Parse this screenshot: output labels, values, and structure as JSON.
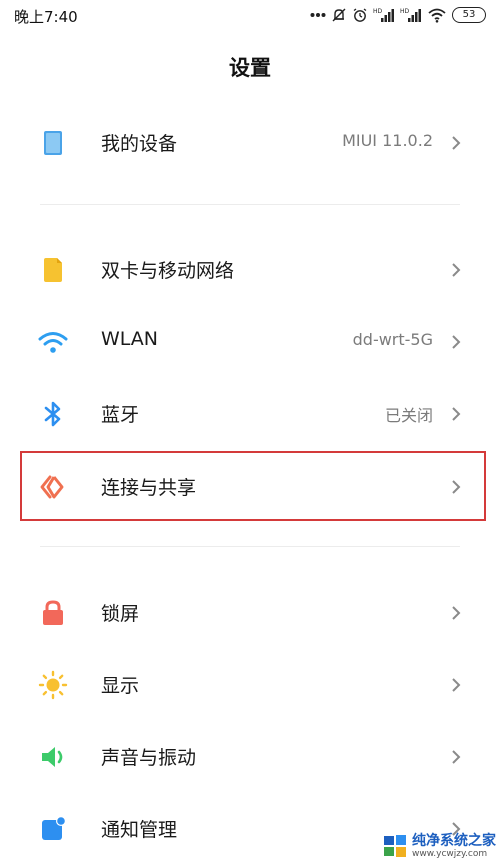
{
  "status_bar": {
    "time": "晚上7:40",
    "battery": "53",
    "icons": [
      "more-dots-icon",
      "alarm-off-icon",
      "alarm-icon",
      "signal-hd-icon",
      "signal-hd-icon",
      "wifi-icon",
      "battery-icon"
    ]
  },
  "title": "设置",
  "items": {
    "my_device": {
      "label": "我的设备",
      "value": "MIUI 11.0.2",
      "icon": "device-icon",
      "color": "#4aa3e8"
    },
    "sim": {
      "label": "双卡与移动网络",
      "value": "",
      "icon": "sim-card-icon",
      "color": "#f6c230"
    },
    "wlan": {
      "label": "WLAN",
      "value": "dd-wrt-5G",
      "icon": "wifi-icon",
      "color": "#2d9ef0"
    },
    "bluetooth": {
      "label": "蓝牙",
      "value": "已关闭",
      "icon": "bluetooth-icon",
      "color": "#2d8ff0"
    },
    "connection": {
      "label": "连接与共享",
      "value": "",
      "icon": "connection-share-icon",
      "color": "#f07050"
    },
    "lock": {
      "label": "锁屏",
      "value": "",
      "icon": "lock-icon",
      "color": "#f2685a"
    },
    "display": {
      "label": "显示",
      "value": "",
      "icon": "sun-icon",
      "color": "#f8c030"
    },
    "sound": {
      "label": "声音与振动",
      "value": "",
      "icon": "speaker-icon",
      "color": "#3ccb6a"
    },
    "notification": {
      "label": "通知管理",
      "value": "",
      "icon": "notification-icon",
      "color": "#2d8ff0"
    }
  },
  "highlight_color": "#d43a3a",
  "watermark": {
    "name": "纯净系统之家",
    "url": "www.ycwjzy.com"
  }
}
